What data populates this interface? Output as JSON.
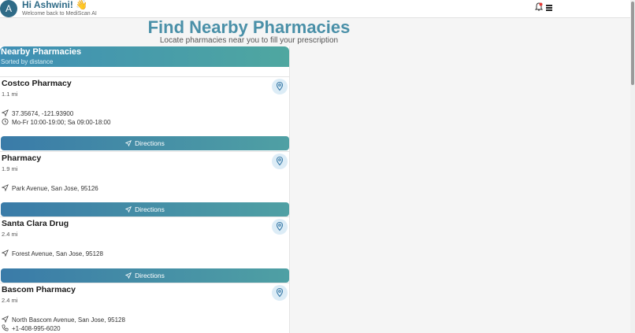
{
  "header": {
    "avatar_letter": "A",
    "greeting": "Hi Ashwini! 👋",
    "subtitle": "Welcome back to MediScan AI"
  },
  "page": {
    "title": "Find Nearby Pharmacies",
    "subtitle": "Locate pharmacies near you to fill your prescription"
  },
  "panel": {
    "title": "Nearby Pharmacies",
    "subtitle": "Sorted by distance"
  },
  "pharmacies": [
    {
      "name": "Costco Pharmacy",
      "distance": "1.1 mi",
      "address": "37.35674, -121.93900",
      "hours": "Mo-Fr 10:00-19:00; Sa 09:00-18:00",
      "directions_label": "Directions"
    },
    {
      "name": "Pharmacy",
      "distance": "1.9 mi",
      "address": "Park Avenue, San Jose, 95126",
      "directions_label": "Directions"
    },
    {
      "name": "Santa Clara Drug",
      "distance": "2.4 mi",
      "address": "Forest Avenue, San Jose, 95128",
      "directions_label": "Directions"
    },
    {
      "name": "Bascom Pharmacy",
      "distance": "2.4 mi",
      "address": "North Bascom Avenue, San Jose, 95128",
      "phone": "+1-408-995-6020"
    }
  ],
  "icons": {
    "notifications": "bell-icon",
    "menu": "hamburger-menu-icon",
    "location": "map-pin-icon",
    "navigate": "navigation-arrow-icon",
    "clock": "clock-icon",
    "phone": "phone-icon"
  },
  "colors": {
    "accent": "#4a90a8",
    "brand": "#2f6b87",
    "button_start": "#3a7ba8",
    "button_end": "#4fa0a4"
  }
}
